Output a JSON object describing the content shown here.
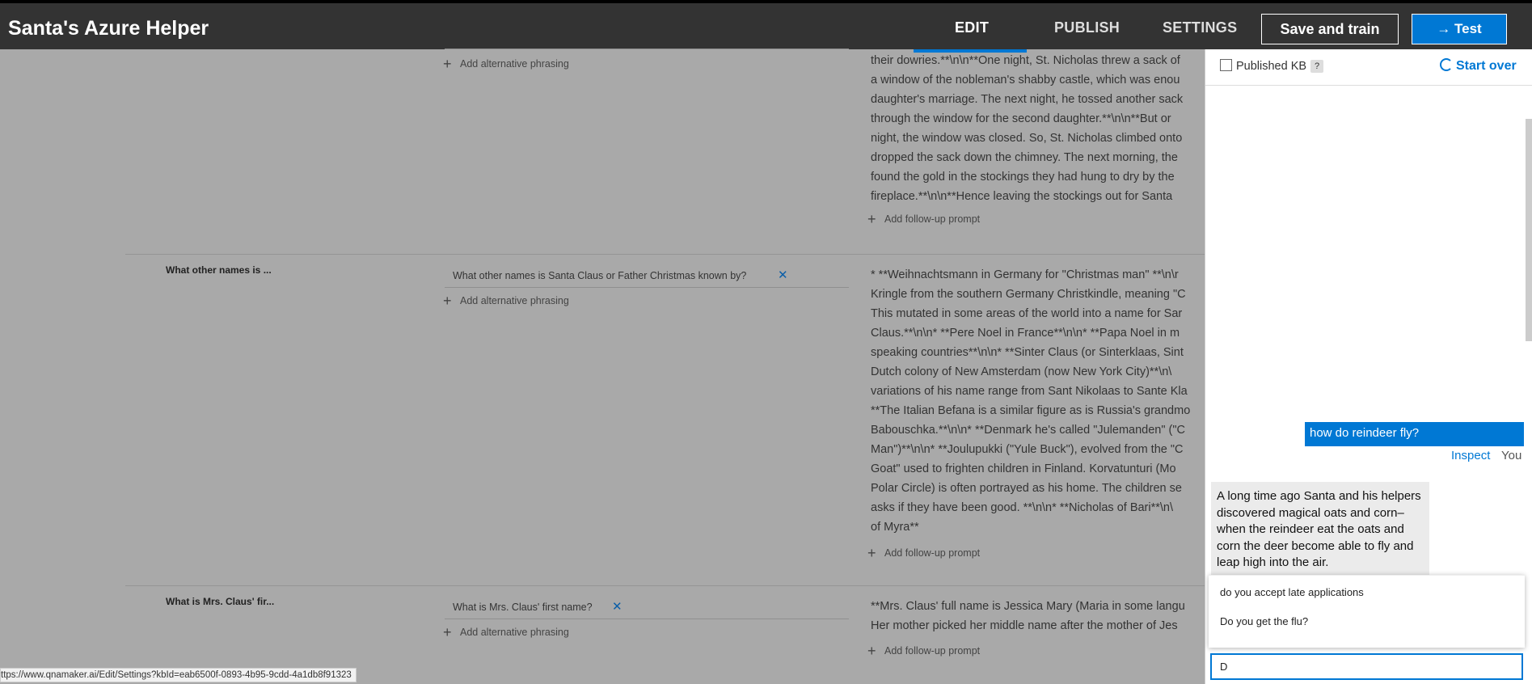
{
  "header": {
    "title": "Santa's Azure Helper",
    "tabs": [
      {
        "label": "EDIT",
        "active": true
      },
      {
        "label": "PUBLISH",
        "active": false
      },
      {
        "label": "SETTINGS",
        "active": false
      }
    ],
    "save_label": "Save and train",
    "test_label": "→ Test"
  },
  "kb": {
    "add_alt_label": "Add alternative phrasing",
    "add_followup_label": "Add follow-up prompt",
    "rows": [
      {
        "question": "",
        "phrase": "",
        "answer_lines": [
          "their dowries.**\\n\\n**One night, St. Nicholas threw a sack of",
          "a window of the nobleman's shabby castle, which was enou",
          "daughter's marriage. The next night, he tossed another sack",
          "through the window for the second daughter.**\\n\\n**But or",
          "night, the window was closed. So, St. Nicholas climbed onto",
          "dropped the sack down the chimney. The next morning, the",
          "found the gold in the stockings they had hung to dry by the",
          "fireplace.**\\n\\n**Hence leaving the stockings out for Santa"
        ]
      },
      {
        "question": "What other names is ...",
        "phrase": "What other names is Santa Claus or Father Christmas known by?",
        "answer_lines": [
          "* **Weihnachtsmann in Germany for \"Christmas man\" **\\n\\r",
          "Kringle from the southern Germany Christkindle, meaning \"C",
          "This mutated in some areas of the world into a name for Sar",
          "Claus.**\\n\\n* **Pere Noel in France**\\n\\n* **Papa Noel in m",
          "speaking countries**\\n\\n* **Sinter Claus (or Sinterklaas, Sint",
          "Dutch colony of New Amsterdam (now New York City)**\\n\\",
          "variations of his name range from Sant Nikolaas to Sante Kla",
          "**The Italian Befana is a similar figure as is Russia's grandmo",
          "Babouschka.**\\n\\n* **Denmark he's called \"Julemanden\" (\"C",
          "Man\")**\\n\\n* **Joulupukki (\"Yule Buck\"), evolved from the \"C",
          "Goat\" used to frighten children in Finland. Korvatunturi (Mo",
          "Polar Circle) is often portrayed as his home. The children se",
          "asks if they have been good. **\\n\\n* **Nicholas of Bari**\\n\\",
          "of Myra**"
        ]
      },
      {
        "question": "What is Mrs. Claus' fir...",
        "phrase": "What is Mrs. Claus' first name?",
        "answer_lines": [
          "**Mrs. Claus' full name is Jessica Mary (Maria in some langu",
          "Her mother picked her middle name after the mother of Jes"
        ]
      }
    ]
  },
  "chat": {
    "published_label": "Published KB",
    "help_glyph": "?",
    "start_over": "Start over",
    "user_message": "how do reindeer fly?",
    "inspect_label": "Inspect",
    "you_label": "You",
    "bot_lines": [
      "A long time ago Santa and his helpers",
      "discovered magical oats and corn–",
      "when the reindeer eat the oats and",
      "corn the deer become able to fly and",
      "leap high into the air."
    ],
    "suggestions": [
      "do you accept late applications",
      "Do you get the flu?"
    ],
    "input_value": "D"
  },
  "status_url": "ttps://www.qnamaker.ai/Edit/Settings?kbId=eab6500f-0893-4b95-9cdd-4a1db8f91323"
}
